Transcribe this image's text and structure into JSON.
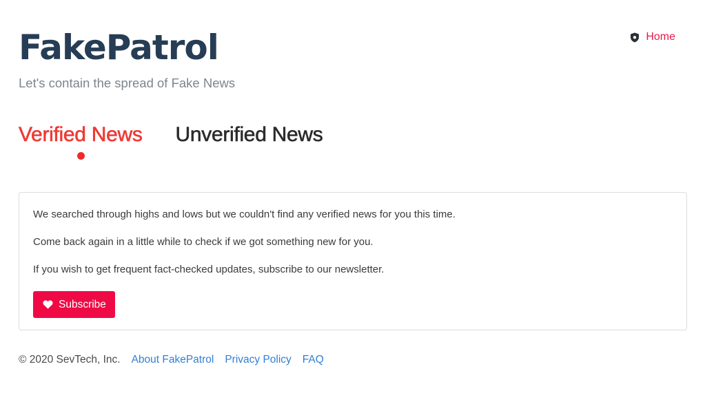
{
  "header": {
    "title": "FakePatrol",
    "tagline": "Let's contain the spread of Fake News",
    "nav": {
      "home_label": "Home",
      "home_icon": "shield-icon"
    }
  },
  "tabs": [
    {
      "label": "Verified News",
      "active": true
    },
    {
      "label": "Unverified News",
      "active": false
    }
  ],
  "notice": {
    "lines": [
      "We searched through highs and lows but we couldn't find any verified news for you this time.",
      "Come back again in a little while to check if we got something new for you.",
      "If you wish to get frequent fact-checked updates, subscribe to our newsletter."
    ],
    "subscribe_label": "Subscribe",
    "subscribe_icon": "heart-icon"
  },
  "footer": {
    "copyright": "© 2020 SevTech, Inc.",
    "links": [
      "About FakePatrol",
      "Privacy Policy",
      "FAQ"
    ]
  },
  "colors": {
    "brand": "#263d55",
    "accent": "#ef0a45",
    "active_tab": "#ee3a35",
    "link": "#2f7fd6"
  }
}
